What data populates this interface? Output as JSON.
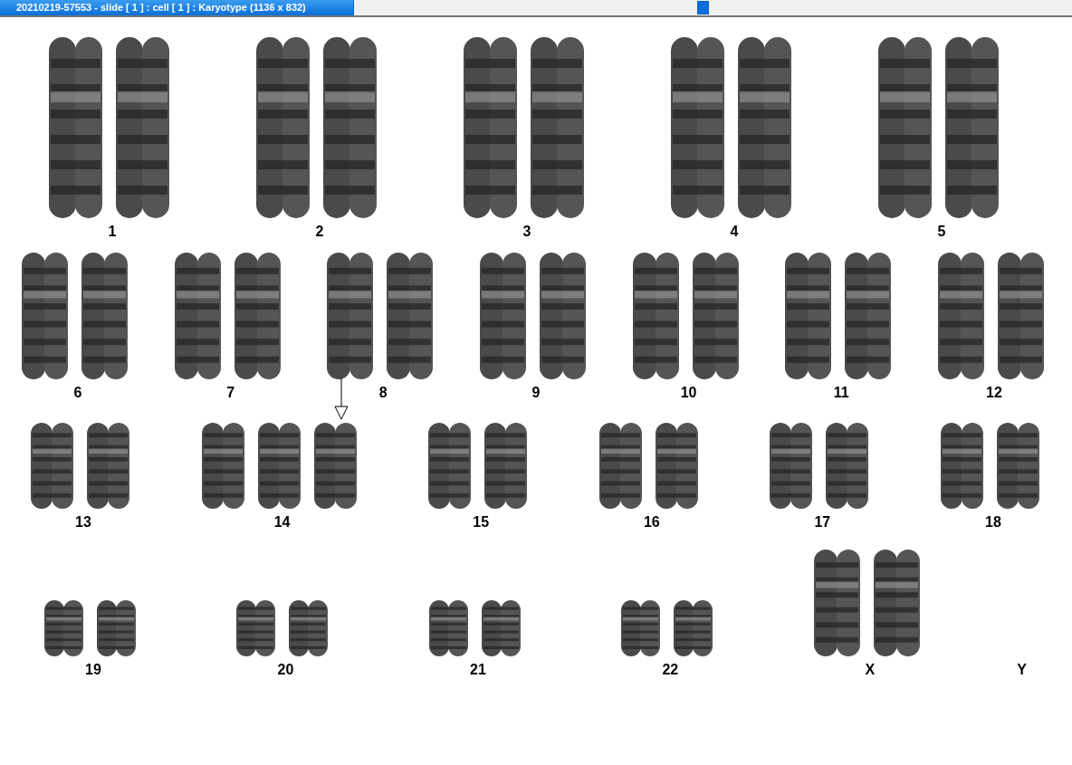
{
  "window": {
    "title": "20210219-57553 - slide [ 1 ] : cell [ 1 ] : Karyotype  (1136 x 832)"
  },
  "rows": [
    {
      "groups": [
        {
          "label": "1",
          "kind": "pair"
        },
        {
          "label": "2",
          "kind": "pair"
        },
        {
          "label": "3",
          "kind": "pair"
        },
        {
          "label": "4",
          "kind": "pair"
        },
        {
          "label": "5",
          "kind": "pair"
        }
      ]
    },
    {
      "groups": [
        {
          "label": "6",
          "kind": "pair"
        },
        {
          "label": "7",
          "kind": "pair"
        },
        {
          "label": "8",
          "kind": "pair"
        },
        {
          "label": "9",
          "kind": "pair"
        },
        {
          "label": "10",
          "kind": "pair"
        },
        {
          "label": "11",
          "kind": "pair"
        },
        {
          "label": "12",
          "kind": "pair"
        }
      ]
    },
    {
      "groups": [
        {
          "label": "13",
          "kind": "pair"
        },
        {
          "label": "14",
          "kind": "trisomy"
        },
        {
          "label": "15",
          "kind": "pair"
        },
        {
          "label": "16",
          "kind": "pair"
        },
        {
          "label": "17",
          "kind": "pair"
        },
        {
          "label": "18",
          "kind": "pair"
        }
      ]
    },
    {
      "groups": [
        {
          "label": "19",
          "kind": "pair"
        },
        {
          "label": "20",
          "kind": "pair"
        },
        {
          "label": "21",
          "kind": "pair"
        },
        {
          "label": "22",
          "kind": "pair"
        },
        {
          "label": "X",
          "kind": "sex-pair"
        },
        {
          "label": "Y",
          "kind": "absent"
        }
      ]
    }
  ]
}
